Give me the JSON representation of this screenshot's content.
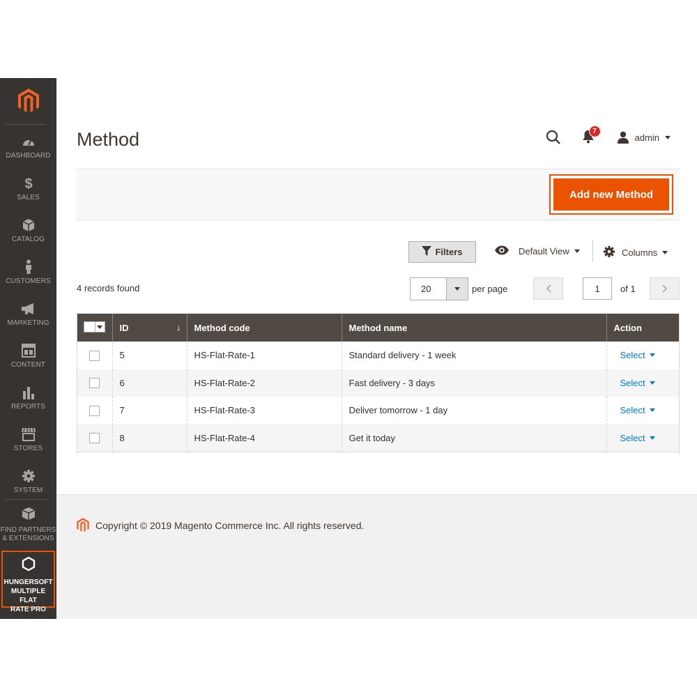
{
  "sidebar": {
    "items": [
      {
        "label": "DASHBOARD",
        "icon": "dashboard-icon"
      },
      {
        "label": "SALES",
        "icon": "dollar-icon"
      },
      {
        "label": "CATALOG",
        "icon": "cube-icon"
      },
      {
        "label": "CUSTOMERS",
        "icon": "person-icon"
      },
      {
        "label": "MARKETING",
        "icon": "megaphone-icon"
      },
      {
        "label": "CONTENT",
        "icon": "layout-icon"
      },
      {
        "label": "REPORTS",
        "icon": "bar-chart-icon"
      },
      {
        "label": "STORES",
        "icon": "storefront-icon"
      },
      {
        "label": "SYSTEM",
        "icon": "gear-icon"
      }
    ],
    "extensions": {
      "line1": "FIND PARTNERS",
      "line2": "& EXTENSIONS"
    },
    "custom": {
      "line1": "HUNGERSOFT",
      "line2": "MULTIPLE FLAT",
      "line3": "RATE PRO"
    }
  },
  "header": {
    "title": "Method",
    "notifications_count": "7",
    "username": "admin"
  },
  "page_actions": {
    "add_label": "Add new Method"
  },
  "toolbar": {
    "filters_label": "Filters",
    "view_label": "Default View",
    "columns_label": "Columns",
    "records_found": "4 records found",
    "per_page_value": "20",
    "per_page_label": "per page",
    "page_current": "1",
    "page_of": "of 1"
  },
  "table": {
    "columns": [
      "ID",
      "Method code",
      "Method name",
      "Action"
    ],
    "rows": [
      {
        "id": "5",
        "code": "HS-Flat-Rate-1",
        "name": "Standard delivery - 1 week",
        "action": "Select"
      },
      {
        "id": "6",
        "code": "HS-Flat-Rate-2",
        "name": "Fast delivery - 3 days",
        "action": "Select"
      },
      {
        "id": "7",
        "code": "HS-Flat-Rate-3",
        "name": "Deliver tomorrow - 1 day",
        "action": "Select"
      },
      {
        "id": "8",
        "code": "HS-Flat-Rate-4",
        "name": "Get it today",
        "action": "Select"
      }
    ]
  },
  "footer": {
    "copyright": "Copyright © 2019 Magento Commerce Inc. All rights reserved."
  },
  "colors": {
    "sidebar_bg": "#373330",
    "accent": "#eb5202",
    "table_header": "#514943",
    "link": "#007bdb"
  }
}
